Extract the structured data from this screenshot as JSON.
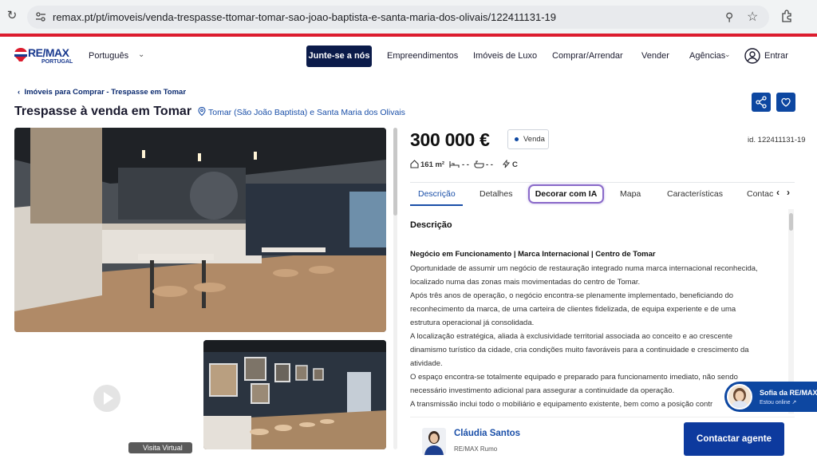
{
  "browser": {
    "url": "remax.pt/pt/imoveis/venda-trespasse-ttomar-tomar-sao-joao-baptista-e-santa-maria-dos-olivais/122411131-19"
  },
  "header": {
    "logo_text": "RE/MAX",
    "logo_sub": "PORTUGAL",
    "language": "Português",
    "join_label": "Junte-se a nós",
    "nav": [
      "Empreendimentos",
      "Imóveis de Luxo",
      "Comprar/Arrendar",
      "Vender",
      "Agências"
    ],
    "login_label": "Entrar"
  },
  "breadcrumb": "Imóveis para Comprar - Trespasse em Tomar",
  "title": "Trespasse à venda em Tomar",
  "location": "Tomar (São João Baptista) e Santa Maria dos Olivais",
  "gallery": {
    "virtual_tour_label": "Visita Virtual"
  },
  "listing": {
    "price": "300 000 €",
    "status": "Venda",
    "id_label": "id. 122411131-19",
    "area": "161 m²",
    "rooms": "- -",
    "bathrooms": "- -",
    "energy": "C"
  },
  "tabs": [
    "Descrição",
    "Detalhes",
    "Decorar com IA",
    "Mapa",
    "Características",
    "Contac"
  ],
  "description": {
    "heading": "Descrição",
    "highlight": "Negócio em Funcionamento | Marca Internacional | Centro de Tomar",
    "lines": [
      "Oportunidade de assumir um negócio de restauração integrado numa marca internacional reconhecida,",
      "localizado numa das zonas mais movimentadas do centro de Tomar.",
      "Após três anos de operação, o negócio encontra-se plenamente implementado, beneficiando do",
      "reconhecimento da marca, de uma carteira de clientes fidelizada, de equipa experiente e de uma",
      "estrutura operacional já consolidada.",
      "A localização estratégica, aliada à exclusividade territorial associada ao conceito e ao crescente",
      "dinamismo turístico da cidade, cria condições muito favoráveis para a continuidade e crescimento da",
      "atividade.",
      "O espaço encontra-se totalmente equipado e preparado para funcionamento imediato, não sendo",
      "necessário investimento adicional para assegurar a continuidade da operação.",
      "A transmissão inclui todo o mobiliário e equipamento existente, bem como a posição contr"
    ]
  },
  "agent": {
    "name": "Cláudia Santos",
    "office": "RE/MAX Rumo",
    "contact_label": "Contactar agente"
  },
  "chat": {
    "name": "Sofia da RE/MAX",
    "status": "Estou online ↗"
  }
}
